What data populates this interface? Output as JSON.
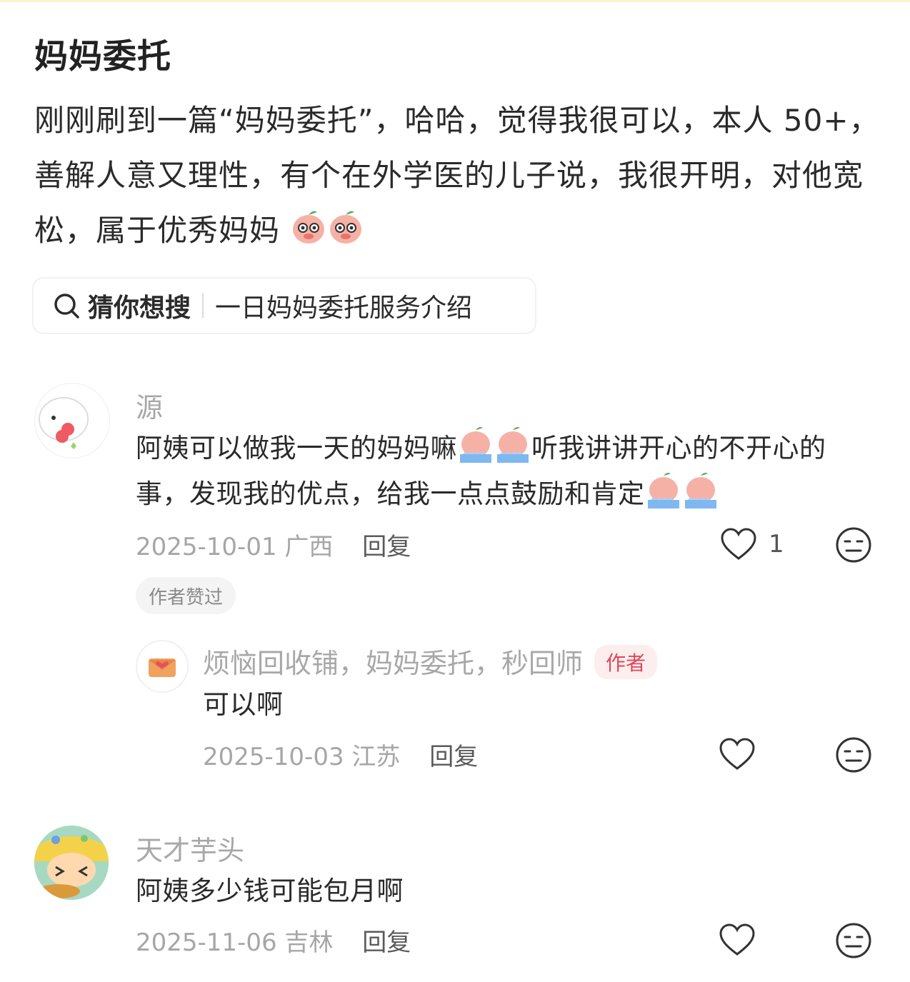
{
  "post": {
    "title": "妈妈委托",
    "body": "刚刚刷到一篇“妈妈委托”，哈哈，觉得我很可以，本人 50+，善解人意又理性，有个在外学医的儿子说，我很开明，对他宽松，属于优秀妈妈"
  },
  "search": {
    "hint": "猜你想搜",
    "query": "一日妈妈委托服务介绍"
  },
  "comments": [
    {
      "name": "源",
      "text_part1": "阿姨可以做我一天的妈妈嘛",
      "text_part2": "听我讲讲开心的不开心的事，发现我的优点，给我一点点鼓励和肯定",
      "date": "2025-10-01",
      "location": "广西",
      "reply_label": "回复",
      "likes": "1",
      "badge": "作者赞过",
      "reply": {
        "name": "烦恼回收铺，妈妈委托，秒回师",
        "author_tag": "作者",
        "text": "可以啊",
        "date": "2025-10-03",
        "location": "江苏",
        "reply_label": "回复"
      }
    },
    {
      "name": "天才芋头",
      "text": "阿姨多少钱可能包月啊",
      "date": "2025-11-06",
      "location": "吉林",
      "reply_label": "回复"
    }
  ]
}
